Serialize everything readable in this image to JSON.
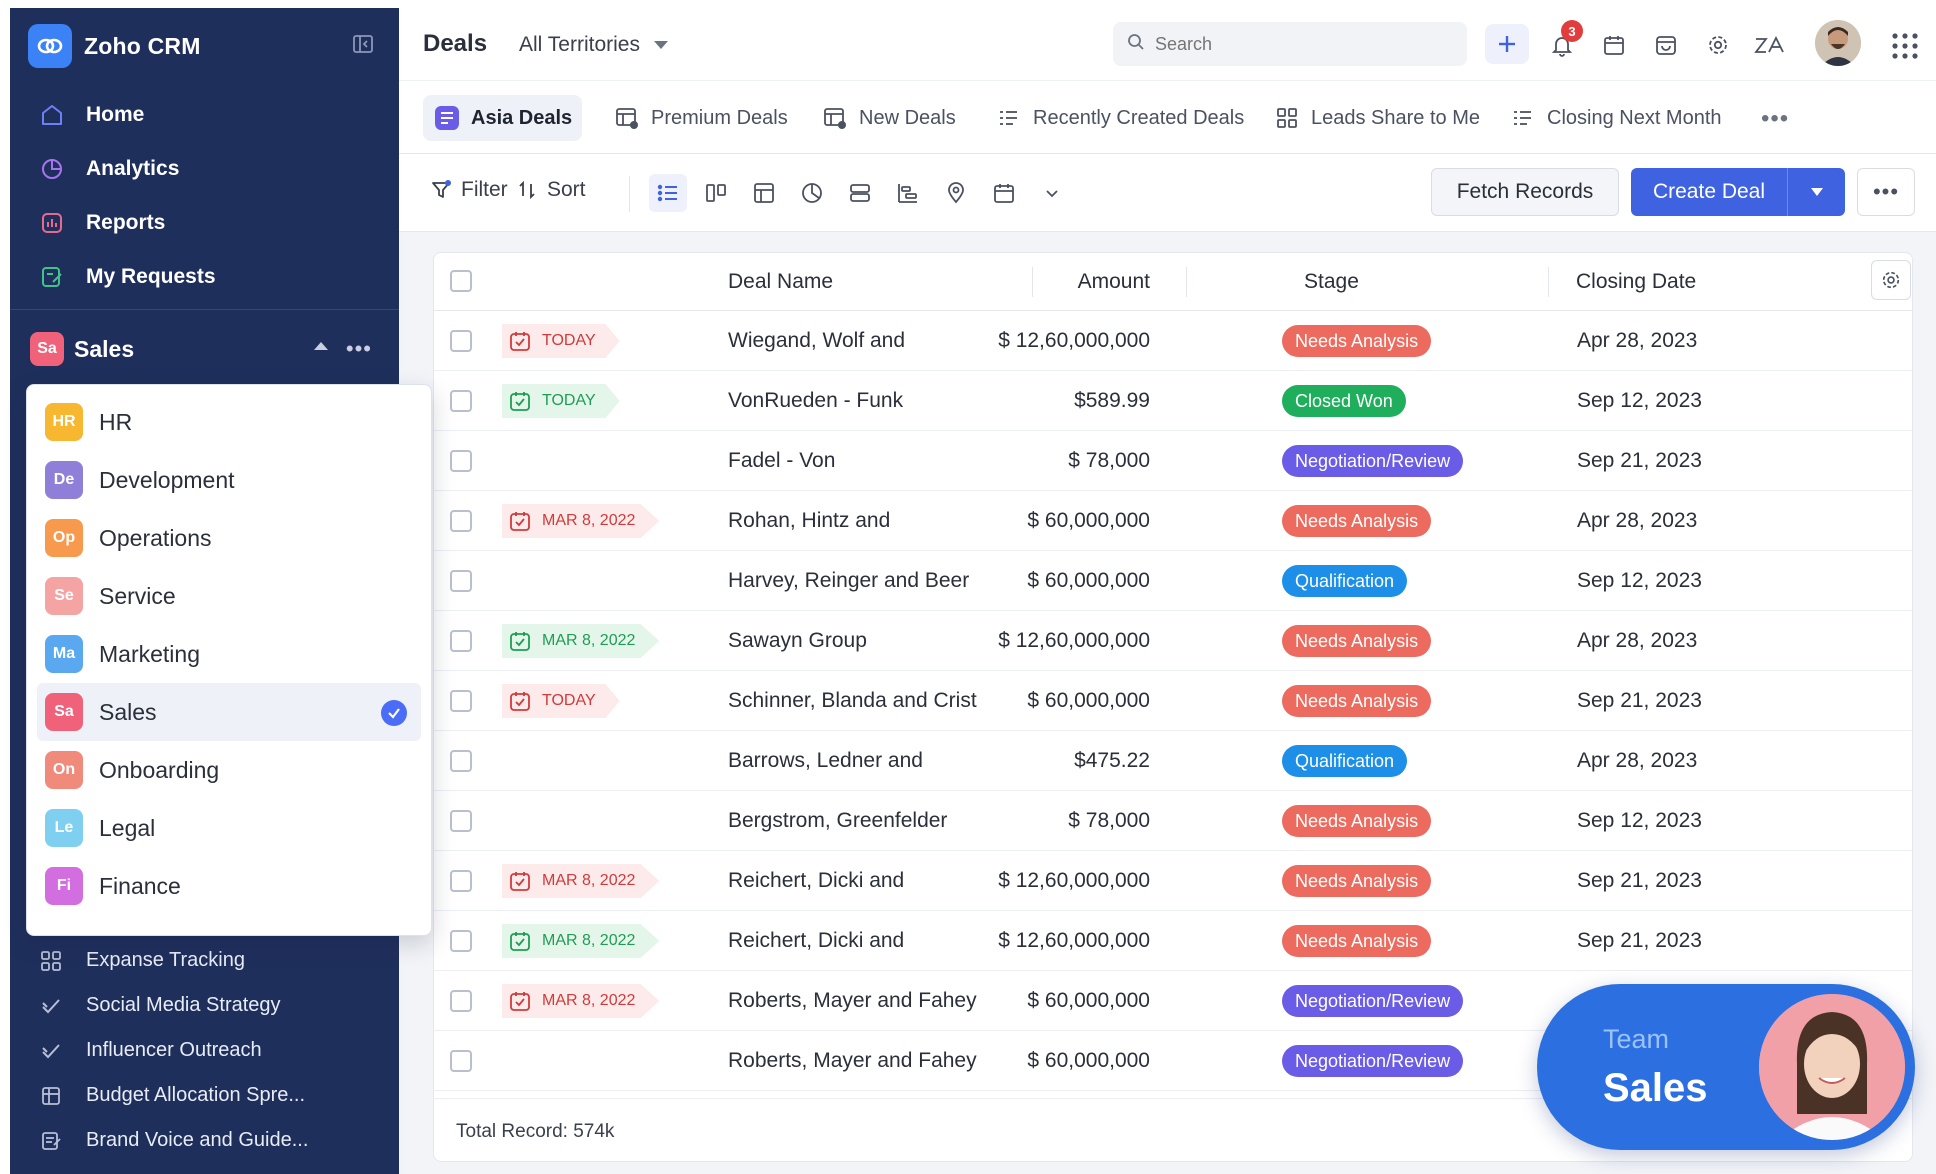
{
  "app": {
    "name": "Zoho CRM"
  },
  "nav": [
    {
      "label": "Home",
      "icon": "home-icon"
    },
    {
      "label": "Analytics",
      "icon": "analytics-icon"
    },
    {
      "label": "Reports",
      "icon": "reports-icon"
    },
    {
      "label": "My Requests",
      "icon": "requests-icon"
    }
  ],
  "team_switcher": {
    "badge": "Sa",
    "label": "Sales"
  },
  "teams": [
    {
      "badge": "HR",
      "label": "HR",
      "color": "#f7b731"
    },
    {
      "badge": "De",
      "label": "Development",
      "color": "#8f7fd9"
    },
    {
      "badge": "Op",
      "label": "Operations",
      "color": "#f79a4d"
    },
    {
      "badge": "Se",
      "label": "Service",
      "color": "#f5a4a4"
    },
    {
      "badge": "Ma",
      "label": "Marketing",
      "color": "#5aa9f0"
    },
    {
      "badge": "Sa",
      "label": "Sales",
      "color": "#f0627a",
      "selected": true
    },
    {
      "badge": "On",
      "label": "Onboarding",
      "color": "#f08a7a"
    },
    {
      "badge": "Le",
      "label": "Legal",
      "color": "#7fd0f0"
    },
    {
      "badge": "Fi",
      "label": "Finance",
      "color": "#d36ee0"
    }
  ],
  "sidebar_list": [
    {
      "label": "Expanse Tracking",
      "icon": "grid-icon"
    },
    {
      "label": "Social Media Strategy",
      "icon": "check-icon"
    },
    {
      "label": "Influencer Outreach",
      "icon": "check-icon"
    },
    {
      "label": "Budget Allocation Spre...",
      "icon": "spreadsheet-icon"
    },
    {
      "label": "Brand Voice and Guide...",
      "icon": "document-icon"
    }
  ],
  "header": {
    "module": "Deals",
    "territory": "All Territories",
    "search_placeholder": "Search",
    "notification_count": "3"
  },
  "views": [
    {
      "label": "Asia Deals",
      "active": true
    },
    {
      "label": "Premium Deals"
    },
    {
      "label": "New Deals"
    },
    {
      "label": "Recently Created Deals"
    },
    {
      "label": "Leads Share to Me"
    },
    {
      "label": "Closing Next Month"
    }
  ],
  "toolbar": {
    "filter": "Filter",
    "sort": "Sort",
    "fetch": "Fetch Records",
    "create": "Create Deal"
  },
  "table": {
    "columns": [
      "Deal Name",
      "Amount",
      "Stage",
      "Closing Date"
    ],
    "rows": [
      {
        "tag": "TODAY",
        "tag_color": "red",
        "deal": "Wiegand, Wolf and",
        "amount": "$ 12,60,000,000",
        "stage": "Needs Analysis",
        "date": "Apr 28, 2023"
      },
      {
        "tag": "TODAY",
        "tag_color": "green",
        "deal": "VonRueden - Funk",
        "amount": "$589.99",
        "stage": "Closed Won",
        "date": "Sep 12, 2023"
      },
      {
        "tag": "",
        "tag_color": "",
        "deal": "Fadel - Von",
        "amount": "$ 78,000",
        "stage": "Negotiation/Review",
        "date": "Sep 21, 2023"
      },
      {
        "tag": "MAR 8, 2022",
        "tag_color": "red",
        "deal": "Rohan, Hintz and",
        "amount": "$ 60,000,000",
        "stage": "Needs Analysis",
        "date": "Apr 28, 2023"
      },
      {
        "tag": "",
        "tag_color": "",
        "deal": "Harvey, Reinger and Beer",
        "amount": "$ 60,000,000",
        "stage": "Qualification",
        "date": "Sep 12, 2023"
      },
      {
        "tag": "MAR 8, 2022",
        "tag_color": "green",
        "deal": "Sawayn Group",
        "amount": "$ 12,60,000,000",
        "stage": "Needs Analysis",
        "date": "Apr 28, 2023"
      },
      {
        "tag": "TODAY",
        "tag_color": "red",
        "deal": "Schinner, Blanda and Crist",
        "amount": "$ 60,000,000",
        "stage": "Needs Analysis",
        "date": "Sep 21, 2023"
      },
      {
        "tag": "",
        "tag_color": "",
        "deal": "Barrows, Ledner and",
        "amount": "$475.22",
        "stage": "Qualification",
        "date": "Apr 28, 2023"
      },
      {
        "tag": "",
        "tag_color": "",
        "deal": "Bergstrom, Greenfelder",
        "amount": "$ 78,000",
        "stage": "Needs Analysis",
        "date": "Sep 12, 2023"
      },
      {
        "tag": "MAR 8, 2022",
        "tag_color": "red",
        "deal": "Reichert, Dicki and",
        "amount": "$ 12,60,000,000",
        "stage": "Needs Analysis",
        "date": "Sep 21, 2023"
      },
      {
        "tag": "MAR 8, 2022",
        "tag_color": "green",
        "deal": "Reichert, Dicki and",
        "amount": "$ 12,60,000,000",
        "stage": "Needs Analysis",
        "date": "Sep 21, 2023"
      },
      {
        "tag": "MAR 8, 2022",
        "tag_color": "red",
        "deal": "Roberts, Mayer and Fahey",
        "amount": "$ 60,000,000",
        "stage": "Negotiation/Review",
        "date": ""
      },
      {
        "tag": "",
        "tag_color": "",
        "deal": "Roberts, Mayer and Fahey",
        "amount": "$ 60,000,000",
        "stage": "Negotiation/Review",
        "date": ""
      }
    ],
    "footer": "Total Record: 574k"
  },
  "stage_colors": {
    "Needs Analysis": "#ec6b5e",
    "Closed Won": "#1fae5b",
    "Negotiation/Review": "#6a5ce6",
    "Qualification": "#1e8fe8"
  },
  "team_bubble": {
    "small": "Team",
    "big": "Sales"
  }
}
